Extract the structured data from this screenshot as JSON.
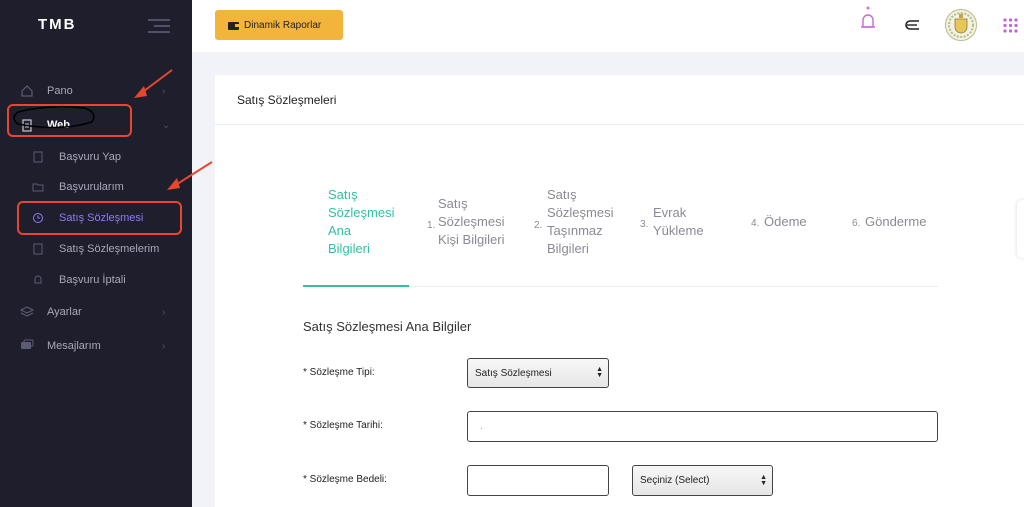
{
  "brand": {
    "logo_text": "TMB"
  },
  "sidebar": {
    "items": [
      {
        "label": "Pano",
        "icon": "home-icon"
      },
      {
        "label": "Web",
        "icon": "clipboard-icon"
      },
      {
        "label": "Ayarlar",
        "icon": "layers-icon"
      },
      {
        "label": "Mesajlarım",
        "icon": "chat-icon"
      }
    ],
    "sub_items": [
      {
        "label": "Başvuru Yap"
      },
      {
        "label": "Başvurularım"
      },
      {
        "label": "Satış Sözleşmesi"
      },
      {
        "label": "Satış Sözleşmelerim"
      },
      {
        "label": "Başvuru İptali"
      }
    ]
  },
  "topbar": {
    "report_button": "Dinamik Raporlar"
  },
  "card": {
    "title": "Satış Sözleşmeleri"
  },
  "steps": [
    {
      "num": "",
      "label": "Satış\nSözleşmesi\nAna\nBilgileri"
    },
    {
      "num": "1.",
      "label": "Satış\nSözleşmesi\nKişi Bilgileri"
    },
    {
      "num": "2.",
      "label": "Satış\nSözleşmesi\nTaşınmaz\nBilgileri"
    },
    {
      "num": "3.",
      "label": "Evrak\nYükleme"
    },
    {
      "num": "4.",
      "label": "Ödeme"
    },
    {
      "num": "6.",
      "label": "Gönderme"
    }
  ],
  "form": {
    "section_title": "Satış Sözleşmesi Ana Bilgiler",
    "contract_type_label": "* Sözleşme Tipi:",
    "contract_type_value": "Satış Sözleşmesi",
    "contract_date_label": "* Sözleşme Tarihi:",
    "contract_date_value": ".",
    "contract_price_label": "* Sözleşme Bedeli:",
    "contract_price_value": "",
    "currency_value": "Seçiniz (Select)"
  },
  "colors": {
    "sidebar_bg": "#1e1e2d",
    "accent": "#34bfa3",
    "active_menu": "#8d7cf8",
    "report_button": "#f3b43b",
    "annotation": "#e8472d"
  }
}
